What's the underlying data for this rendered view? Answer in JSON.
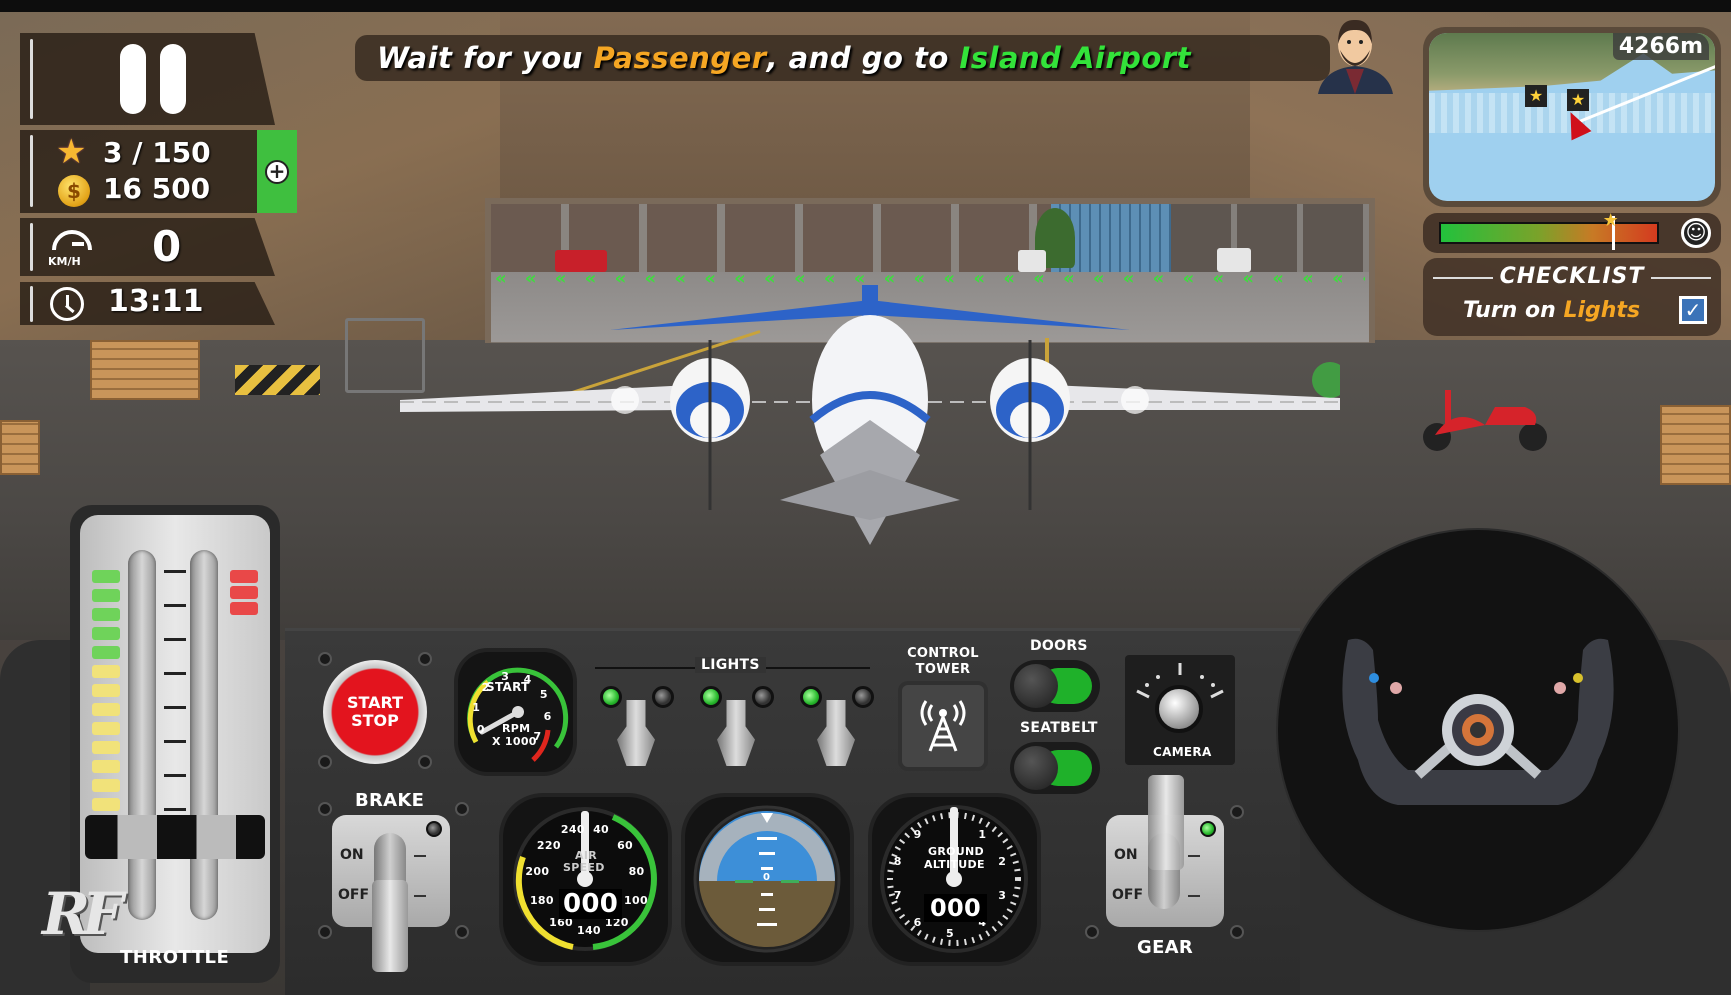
{
  "mission": {
    "prefix": "Wait for you ",
    "passenger": "Passenger",
    "middle": ", and go to ",
    "destination": "Island Airport",
    "colors": {
      "passenger": "#f5a623",
      "destination": "#33e33a"
    }
  },
  "hud": {
    "pause_icon": "pause-icon",
    "stars": "3 / 150",
    "coins": "16 500",
    "add_icon": "plus-icon",
    "speed_value": "0",
    "speed_unit": "KM/H",
    "clock": "13:11"
  },
  "minimap": {
    "distance": "4266m",
    "markers": [
      "star-marker",
      "star-marker",
      "player-arrow"
    ]
  },
  "rating": {
    "level_fraction": 0.79,
    "face_icon": "smiley-icon"
  },
  "checklist": {
    "title": "CHECKLIST",
    "item_prefix": "Turn on ",
    "item_highlight": "Lights",
    "checked": true,
    "check_glyph": "✓"
  },
  "throttle": {
    "label": "THROTTLE",
    "level_fraction": 0.0,
    "logo": "RF"
  },
  "panel": {
    "start_stop": [
      "START",
      "STOP"
    ],
    "rpm": {
      "title": "START",
      "unit": "RPM",
      "multiplier": "X 1000",
      "ticks": [
        "0",
        "1",
        "2",
        "3",
        "4",
        "5",
        "6",
        "7"
      ],
      "value": 0
    },
    "lights": {
      "label": "LIGHTS",
      "switches": [
        {
          "on": true
        },
        {
          "on": true
        },
        {
          "on": true
        }
      ]
    },
    "control_tower": {
      "label_line1": "CONTROL",
      "label_line2": "TOWER"
    },
    "doors": {
      "label": "DOORS",
      "on": true
    },
    "seatbelt": {
      "label": "SEATBELT",
      "on": true
    },
    "camera": {
      "label": "CAMERA"
    },
    "brake": {
      "label": "BRAKE",
      "on": "ON",
      "off": "OFF",
      "state": "OFF"
    },
    "gear": {
      "label": "GEAR",
      "on": "ON",
      "off": "OFF",
      "state": "ON"
    },
    "airspeed": {
      "title_1": "AIR",
      "title_2": "SPEED",
      "readout": "000",
      "ticks": [
        "40",
        "60",
        "80",
        "100",
        "120",
        "140",
        "160",
        "180",
        "200",
        "220",
        "240"
      ]
    },
    "attitude": {
      "zero": "0"
    },
    "altitude": {
      "title_1": "GROUND",
      "title_2": "ALTITUDE",
      "readout": "000",
      "ticks": [
        "1",
        "2",
        "3",
        "4",
        "5",
        "6",
        "7",
        "8",
        "9"
      ]
    }
  }
}
